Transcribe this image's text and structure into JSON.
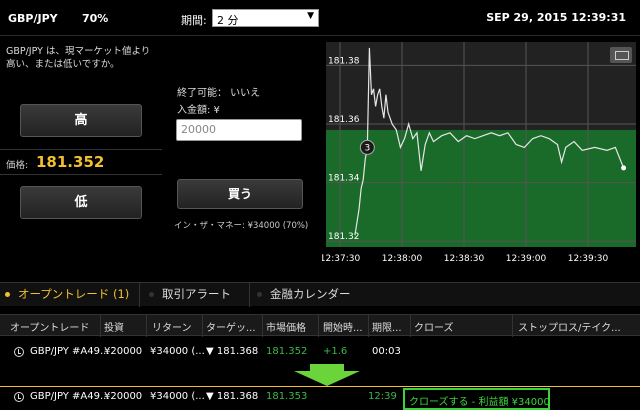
{
  "header": {
    "pair": "GBP/JPY",
    "payout_pct": "70%",
    "period_label": "期間:",
    "period_value": "2 分",
    "datetime": "SEP 29, 2015 12:39:31"
  },
  "left": {
    "description": "GBP/JPY は、現マーケット値より高い、または低いですか。",
    "high_button": "高",
    "price_label": "価格:",
    "price_value": "181.352",
    "low_button": "低"
  },
  "middle": {
    "close_possible": "終了可能： いいえ",
    "amount_label": "入金額: ¥",
    "amount_value": "20000",
    "buy_button": "買う",
    "in_the_money": "イン・ザ・マネー: ¥34000 (70%)"
  },
  "chart_data": {
    "type": "line",
    "x_ticks": [
      "12:37:30",
      "12:38:00",
      "12:38:30",
      "12:39:00",
      "12:39:30"
    ],
    "y_ticks": [
      "181.38",
      "181.36",
      "181.34",
      "181.32"
    ],
    "ylim": [
      181.318,
      181.388
    ],
    "strike": 181.352,
    "strike_label": "3",
    "grid": true,
    "colors": {
      "above_strike": "#222222",
      "below_strike": "#1a6b2a",
      "line": "#e6e6e6"
    },
    "points": [
      [
        0,
        181.322
      ],
      [
        2,
        181.331
      ],
      [
        3,
        181.338
      ],
      [
        4,
        181.341
      ],
      [
        5,
        181.348
      ],
      [
        6,
        181.352
      ],
      [
        7,
        181.386
      ],
      [
        8,
        181.37
      ],
      [
        9,
        181.372
      ],
      [
        10,
        181.366
      ],
      [
        11,
        181.37
      ],
      [
        12,
        181.372
      ],
      [
        13,
        181.366
      ],
      [
        14,
        181.362
      ],
      [
        15,
        181.37
      ],
      [
        16,
        181.364
      ],
      [
        18,
        181.36
      ],
      [
        20,
        181.358
      ],
      [
        22,
        181.352
      ],
      [
        24,
        181.355
      ],
      [
        26,
        181.36
      ],
      [
        28,
        181.355
      ],
      [
        30,
        181.357
      ],
      [
        32,
        181.344
      ],
      [
        34,
        181.353
      ],
      [
        36,
        181.357
      ],
      [
        38,
        181.354
      ],
      [
        42,
        181.356
      ],
      [
        46,
        181.357
      ],
      [
        50,
        181.354
      ],
      [
        54,
        181.356
      ],
      [
        58,
        181.355
      ],
      [
        62,
        181.356
      ],
      [
        66,
        181.357
      ],
      [
        70,
        181.356
      ],
      [
        74,
        181.357
      ],
      [
        78,
        181.353
      ],
      [
        82,
        181.352
      ],
      [
        86,
        181.355
      ],
      [
        90,
        181.356
      ],
      [
        94,
        181.355
      ],
      [
        98,
        181.353
      ],
      [
        100,
        181.347
      ],
      [
        102,
        181.352
      ],
      [
        106,
        181.354
      ],
      [
        110,
        181.351
      ],
      [
        116,
        181.352
      ],
      [
        122,
        181.351
      ],
      [
        126,
        181.352
      ],
      [
        130,
        181.345
      ]
    ]
  },
  "tabs": [
    {
      "label": "オープントレード (1)",
      "active": true
    },
    {
      "label": "取引アラート",
      "active": false
    },
    {
      "label": "金融カレンダー",
      "active": false
    }
  ],
  "table": {
    "headers": [
      "オープントレード",
      "投資",
      "リターン",
      "ターゲッ...",
      "市場価格",
      "開始時...",
      "期限...",
      "クローズ",
      "ストップロス/テイク..."
    ],
    "row1": {
      "trade": "GBP/JPY #A49...",
      "investment": "¥20000",
      "return": "¥34000 (...",
      "target": "▼ 181.368",
      "market": "181.352",
      "change": "+1.6",
      "expiry": "00:03"
    },
    "row2": {
      "trade": "GBP/JPY #A49...",
      "investment": "¥20000",
      "return": "¥34000 (...",
      "target": "▼ 181.368",
      "market": "181.353",
      "time": "12:39",
      "close_action": "クローズする - 利益額 ¥34000"
    }
  }
}
